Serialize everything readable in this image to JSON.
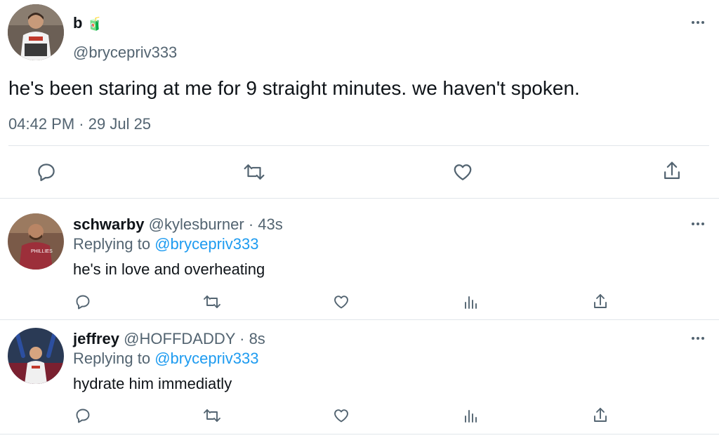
{
  "main_tweet": {
    "display_name": "b",
    "name_emoji": "🧃",
    "handle": "@brycepriv333",
    "text": "he's been staring at me for 9 straight minutes. we haven't spoken.",
    "time": "04:42 PM",
    "separator": "·",
    "date": "29 Jul 25"
  },
  "replies": [
    {
      "display_name": "schwarby",
      "handle": "@kylesburner",
      "time": "· 43s",
      "replying_prefix": "Replying to",
      "replying_to": "@brycepriv333",
      "text": "he's in love and overheating"
    },
    {
      "display_name": "jeffrey",
      "handle": "@HOFFDADDY",
      "time": "· 8s",
      "replying_prefix": "Replying to",
      "replying_to": "@brycepriv333",
      "text": "hydrate him immediatly"
    }
  ],
  "colors": {
    "text": "#0f1419",
    "muted": "#536471",
    "link": "#1d9bf0",
    "divider": "#e1e6ea"
  },
  "icons": [
    "more-icon",
    "reply-icon",
    "retweet-icon",
    "like-icon",
    "views-icon",
    "share-icon"
  ]
}
